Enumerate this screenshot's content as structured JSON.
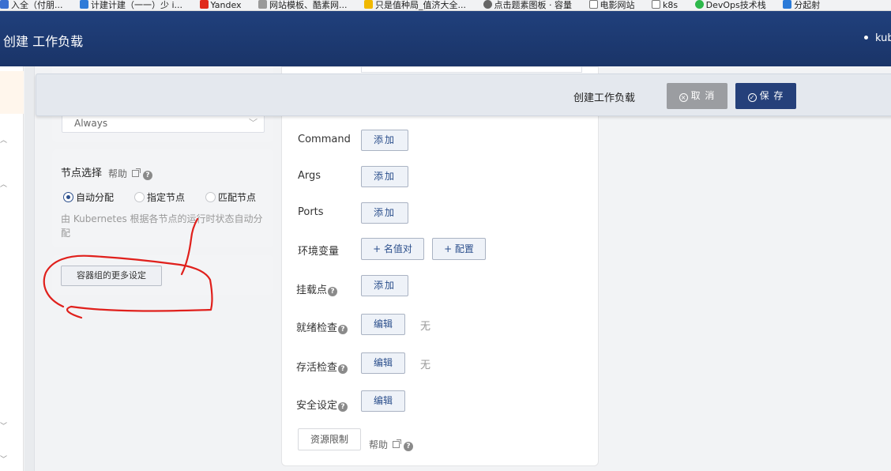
{
  "bookmarks": [
    {
      "label": "入全（付朋..."
    },
    {
      "label": "计建计建（一一）少 i..."
    },
    {
      "label": "Yandex"
    },
    {
      "label": "网站模板、酷素网..."
    },
    {
      "label": "只是值种局_值济大全..."
    },
    {
      "label": "点击题素图板 · 容量"
    },
    {
      "label": "电影网站"
    },
    {
      "label": "k8s"
    },
    {
      "label": "DevOps技术栈"
    },
    {
      "label": "分起射"
    }
  ],
  "header": {
    "title": "创建 工作负载",
    "user": "kub"
  },
  "action_bar": {
    "title": "创建工作负载",
    "cancel_label": "取 消",
    "save_label": "保 存",
    "cancel_icon": "close-circle-icon",
    "save_icon": "check-circle-icon"
  },
  "left_panel": {
    "pull_policy_value": "Always",
    "node_select": {
      "title": "节点选择",
      "help": "帮助",
      "options": [
        "自动分配",
        "指定节点",
        "匹配节点"
      ],
      "selected": "自动分配",
      "description": "由 Kubernetes 根据各节点的运行时状态自动分配"
    },
    "more_settings_label": "容器组的更多设定"
  },
  "form": {
    "command": {
      "label": "Command",
      "button": "添加"
    },
    "args": {
      "label": "Args",
      "button": "添加"
    },
    "ports": {
      "label": "Ports",
      "button": "添加"
    },
    "env": {
      "label": "环境变量",
      "kv_button": "+ 名值对",
      "config_button": "+ 配置"
    },
    "mounts": {
      "label": "挂载点",
      "button": "添加"
    },
    "readiness": {
      "label": "就绪检查",
      "button": "编辑",
      "value": "无"
    },
    "liveness": {
      "label": "存活检查",
      "button": "编辑",
      "value": "无"
    },
    "security": {
      "label": "安全设定",
      "button": "编辑"
    },
    "resources": {
      "label": "资源限制",
      "help": "帮助"
    }
  },
  "colors": {
    "header": "#1f3d78",
    "primary": "#25407a",
    "cancel": "#9b9da1",
    "annotation": "#e0201c"
  }
}
